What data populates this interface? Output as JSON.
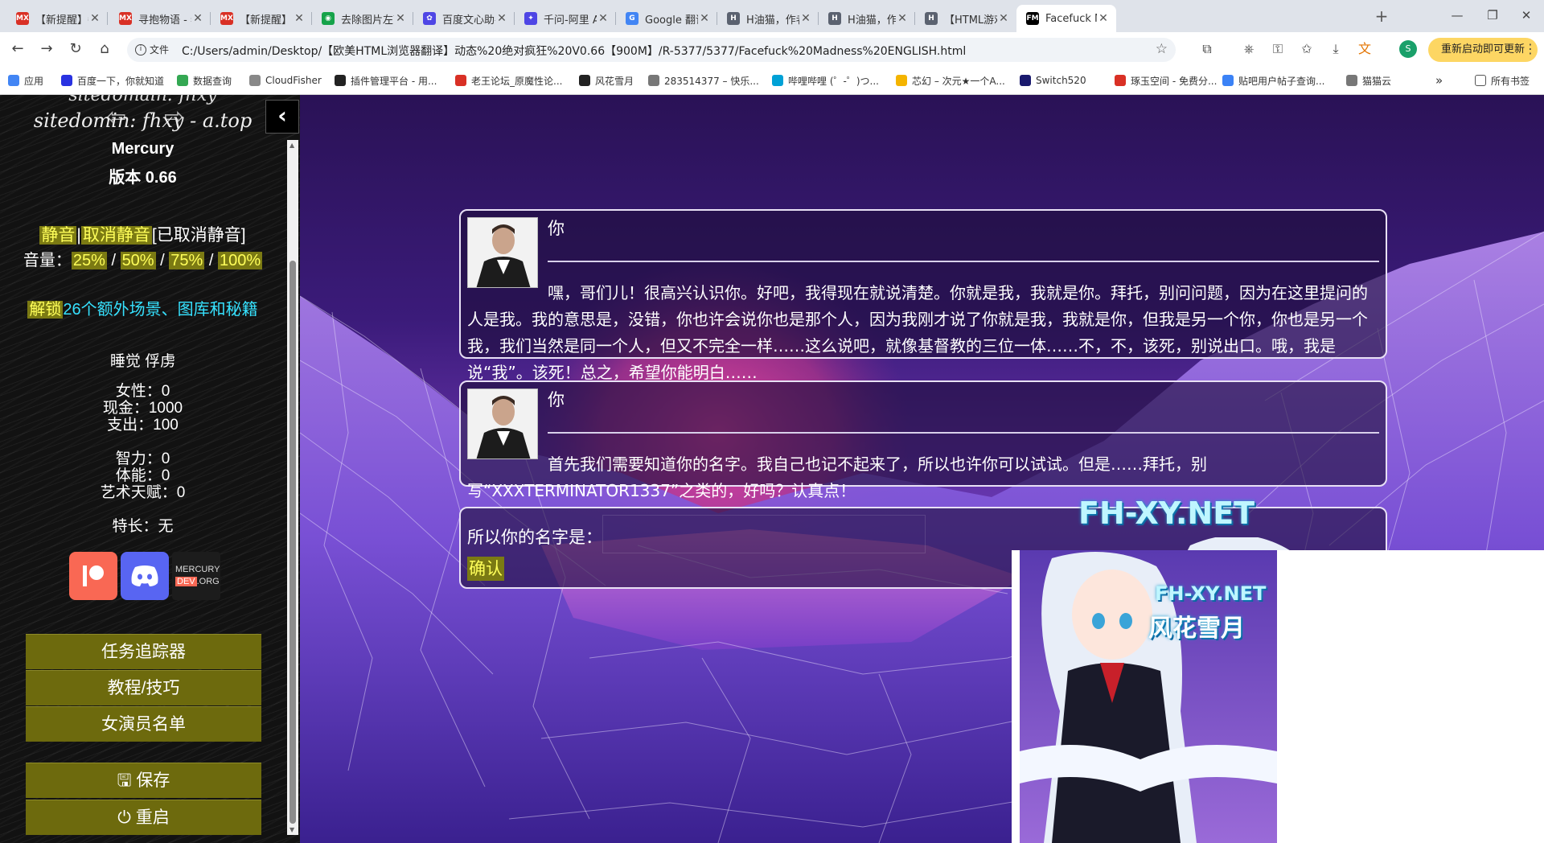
{
  "browser": {
    "tabs": [
      {
        "title": "【新提醒】每日",
        "icon_color": "#d93025",
        "icon_text": "MX"
      },
      {
        "title": "寻抱物语 - 老王",
        "icon_color": "#d93025",
        "icon_text": "MX"
      },
      {
        "title": "【新提醒】[PC",
        "icon_color": "#d93025",
        "icon_text": "MX"
      },
      {
        "title": "去除图片左下角",
        "icon_color": "#16a34a",
        "icon_text": "◉"
      },
      {
        "title": "百度文心助手 -",
        "icon_color": "#4f46e5",
        "icon_text": "✿"
      },
      {
        "title": "千问-阿里 AI 新",
        "icon_color": "#4f46e5",
        "icon_text": "✦"
      },
      {
        "title": "Google 翻译",
        "icon_color": "#4285f4",
        "icon_text": "G"
      },
      {
        "title": "H油猫，作者快",
        "icon_color": "#5b6270",
        "icon_text": "H"
      },
      {
        "title": "H油猫，作者快",
        "icon_color": "#5b6270",
        "icon_text": "H"
      },
      {
        "title": "【HTML游戏/后",
        "icon_color": "#5b6270",
        "icon_text": "H"
      },
      {
        "title": "Facefuck Madness",
        "icon_color": "#000000",
        "icon_text": "FM"
      }
    ],
    "address": {
      "file_label": "文件",
      "url": "C:/Users/admin/Desktop/【欧美HTML浏览器翻译】动态%20绝对疯狂%20V0.66【900M】/R-5377/5377/Facefuck%20Madness%20ENGLISH.html"
    },
    "restart_label": "重新启动即可更新",
    "bookmarks": [
      {
        "label": "应用",
        "icon_color": "#4285f4"
      },
      {
        "label": "百度一下，你就知道",
        "icon_color": "#2932e1"
      },
      {
        "label": "数据查询",
        "icon_color": "#34a853"
      },
      {
        "label": "CloudFisher",
        "icon_color": "#888888"
      },
      {
        "label": "插件管理平台 - 用...",
        "icon_color": "#222222"
      },
      {
        "label": "老王论坛_原魔性论...",
        "icon_color": "#d93025"
      },
      {
        "label": "风花雪月",
        "icon_color": "#222222"
      },
      {
        "label": "283514377 – 快乐...",
        "icon_color": "#777777"
      },
      {
        "label": "哔哩哔哩 (゜-゜)つ...",
        "icon_color": "#00a1d6"
      },
      {
        "label": "芯幻 – 次元★一个A...",
        "icon_color": "#f4b400"
      },
      {
        "label": "Switch520",
        "icon_color": "#1a1a6e"
      },
      {
        "label": "琢玉空间 - 免费分...",
        "icon_color": "#d93025"
      },
      {
        "label": "贴吧用户帖子查询...",
        "icon_color": "#3b82f6"
      },
      {
        "label": "猫猫云",
        "icon_color": "#777777"
      }
    ],
    "bookmarks_more": "»",
    "all_bookmarks": "所有书签"
  },
  "sidebar": {
    "domain_top": "sitedomain: fhxy",
    "domain": "sitedomin: fhxy - a.top",
    "title": "Mercury",
    "version": "版本 0.66",
    "audio": {
      "mute": "静音",
      "sep": "|",
      "unmute": "取消静音",
      "state": "[已取消静音]"
    },
    "volume": {
      "label": "音量：",
      "options": [
        "25%",
        "50%",
        "75%",
        "100%"
      ],
      "sep": " / "
    },
    "unlock": {
      "action": "解锁",
      "text": "26个额外场景、图库和秘籍"
    },
    "status": "睡觉 俘虏",
    "stats": {
      "women": "女性：0",
      "cash": "现金：1000",
      "spend": "支出：100",
      "intelligence": "智力：0",
      "stamina": "体能：0",
      "art": "艺术天赋：0",
      "specialty": "特长：无"
    },
    "social": {
      "mercury_line1": "MERCURY",
      "mercury_dev": "DEV",
      "mercury_org": ".ORG"
    },
    "menu": [
      "任务追踪器",
      "教程/技巧",
      "女演员名单"
    ],
    "save": "保存",
    "restart": "重启"
  },
  "dialogue": [
    {
      "speaker": "你",
      "text": "嘿，哥们儿！很高兴认识你。好吧，我得现在就说清楚。你就是我，我就是你。拜托，别问问题，因为在这里提问的人是我。我的意思是，没错，你也许会说你也是那个人，因为我刚才说了你就是我，我就是你，但我是另一个你，你也是另一个我，我们当然是同一个人，但又不完全一样……这么说吧，就像基督教的三位一体……不，不，该死，别说出口。哦，我是说“我”。该死！总之，希望你能明白……"
    },
    {
      "speaker": "你",
      "text": "首先我们需要知道你的名字。我自己也记不起来了，所以也许你可以试试。但是……拜托，别写“XXXTERMINATOR1337”之类的，好吗？认真点！"
    }
  ],
  "name_prompt": {
    "label": "所以你的名字是：",
    "value": "",
    "confirm": "确认"
  },
  "watermark": {
    "large": "FH-XY.NET",
    "small": "FH-XY.NET",
    "cn": "风花雪月"
  }
}
